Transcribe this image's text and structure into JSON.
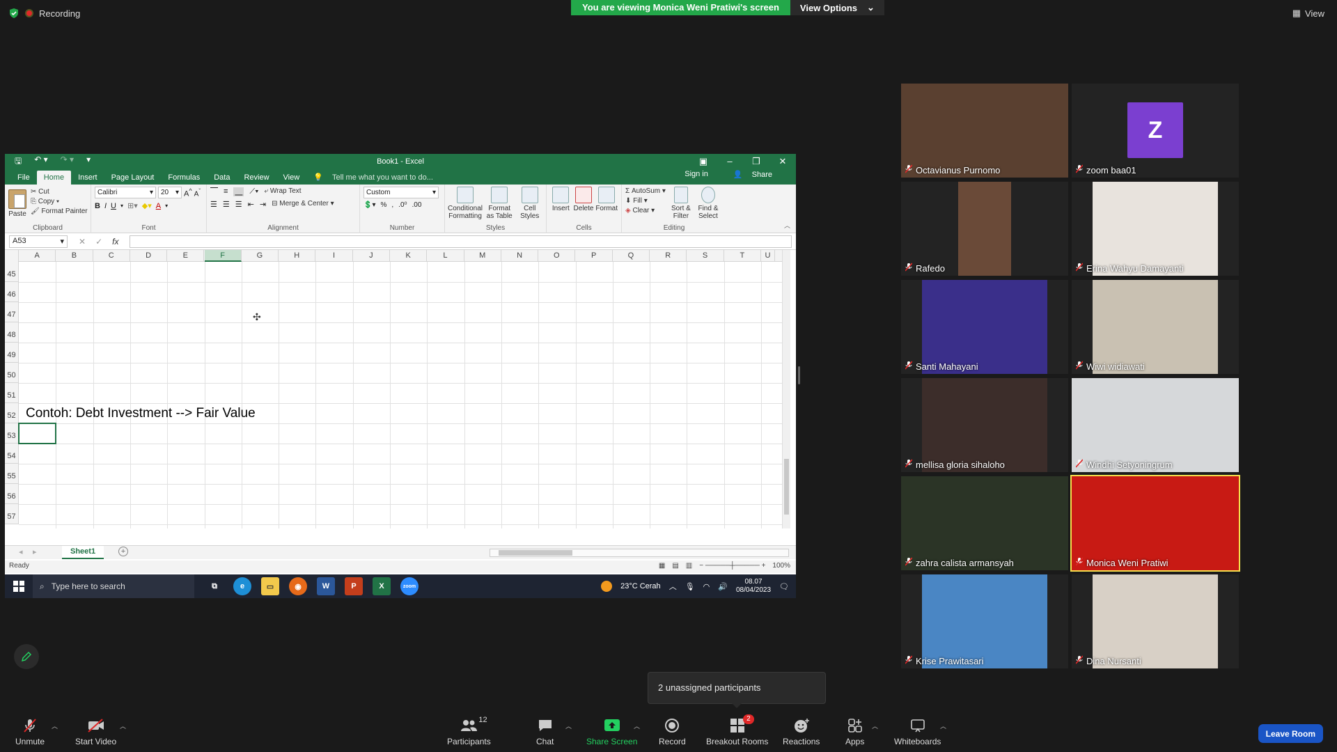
{
  "top": {
    "recording_label": "Recording",
    "viewing_banner": "You are viewing Monica Weni Pratiwi's screen",
    "view_options_label": "View Options",
    "view_label": "View"
  },
  "excel": {
    "window_title": "Book1 - Excel",
    "tabs": [
      "File",
      "Home",
      "Insert",
      "Page Layout",
      "Formulas",
      "Data",
      "Review",
      "View"
    ],
    "active_tab": "Home",
    "tell_me": "Tell me what you want to do...",
    "sign_in": "Sign in",
    "share": "Share",
    "ribbon": {
      "paste": "Paste",
      "cut": "Cut",
      "copy": "Copy",
      "format_painter": "Format Painter",
      "clipboard": "Clipboard",
      "font_name": "Calibri",
      "font_size": "20",
      "font_group": "Font",
      "wrap_text": "Wrap Text",
      "merge_center": "Merge & Center",
      "alignment_group": "Alignment",
      "number_format": "Custom",
      "number_group": "Number",
      "conditional_formatting": "Conditional Formatting",
      "format_as_table": "Format as Table",
      "cell_styles": "Cell Styles",
      "styles_group": "Styles",
      "insert": "Insert",
      "delete": "Delete",
      "format": "Format",
      "cells_group": "Cells",
      "autosum": "AutoSum",
      "fill": "Fill",
      "clear": "Clear",
      "sort_filter": "Sort & Filter",
      "find_select": "Find & Select",
      "editing_group": "Editing"
    },
    "name_box": "A53",
    "columns": [
      "A",
      "B",
      "C",
      "D",
      "E",
      "F",
      "G",
      "H",
      "I",
      "J",
      "K",
      "L",
      "M",
      "N",
      "O",
      "P",
      "Q",
      "R",
      "S",
      "T",
      "U"
    ],
    "selected_column": "F",
    "rows": [
      "45",
      "46",
      "47",
      "48",
      "49",
      "50",
      "51",
      "52",
      "53",
      "54",
      "55",
      "56",
      "57"
    ],
    "cell_a52": "Contoh: Debt Investment --> Fair Value",
    "sheet_tab": "Sheet1",
    "status": "Ready",
    "zoom": "100%"
  },
  "taskbar": {
    "search_placeholder": "Type here to search",
    "weather": "23°C  Cerah",
    "time": "08.07",
    "date": "08/04/2023"
  },
  "participants": [
    {
      "name": "Octavianus Purnomo",
      "color": "#5a4030"
    },
    {
      "name": "zoom baa01",
      "color": "#232323",
      "initial": "Z"
    },
    {
      "name": "Rafedo",
      "color": "#6a4a38"
    },
    {
      "name": "Erina Wahyu Damayanti",
      "color": "#e8e3dd"
    },
    {
      "name": "Santi Mahayani",
      "color": "#3a2f8a"
    },
    {
      "name": "Wiwi widiawati",
      "color": "#c9c1b2"
    },
    {
      "name": "mellisa gloria sihaloho",
      "color": "#3c2d2a"
    },
    {
      "name": "Windhi Setyoningrum",
      "color": "#d6d8da"
    },
    {
      "name": "zahra calista armansyah",
      "color": "#2b3426"
    },
    {
      "name": "Monica Weni Pratiwi",
      "color": "#c81a14"
    },
    {
      "name": "Krise Prawitasari",
      "color": "#4a86c4"
    },
    {
      "name": "Dina Nursanti",
      "color": "#d8d0c6"
    }
  ],
  "toast": "2 unassigned participants",
  "toolbar": {
    "unmute": "Unmute",
    "start_video": "Start Video",
    "participants": "Participants",
    "participant_count": "12",
    "chat": "Chat",
    "share_screen": "Share Screen",
    "record": "Record",
    "breakout_rooms": "Breakout Rooms",
    "breakout_badge": "2",
    "reactions": "Reactions",
    "apps": "Apps",
    "whiteboards": "Whiteboards",
    "leave_room": "Leave Room"
  }
}
